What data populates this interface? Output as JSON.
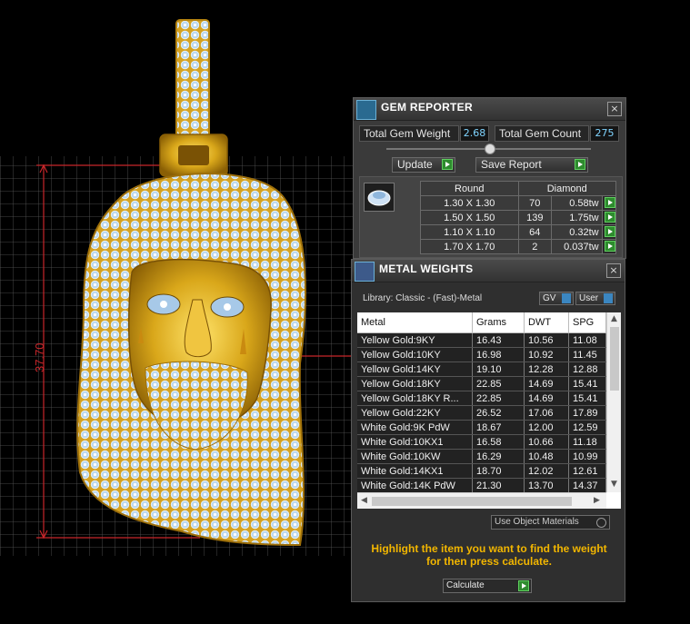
{
  "dimension_label": "37.70",
  "gem_reporter": {
    "title": "GEM REPORTER",
    "close": "×",
    "total_weight_label": "Total Gem Weight",
    "total_weight_value": "2.68",
    "total_count_label": "Total Gem Count",
    "total_count_value": "275",
    "update_label": "Update",
    "save_label": "Save Report",
    "header_shape": "Round",
    "header_material": "Diamond",
    "rows": [
      {
        "size": "1.30 X 1.30",
        "count": "70",
        "weight": "0.58tw"
      },
      {
        "size": "1.50 X 1.50",
        "count": "139",
        "weight": "1.75tw"
      },
      {
        "size": "1.10 X 1.10",
        "count": "64",
        "weight": "0.32tw"
      },
      {
        "size": "1.70 X 1.70",
        "count": "2",
        "weight": "0.037tw"
      }
    ]
  },
  "metal_weights": {
    "title": "METAL WEIGHTS",
    "close": "×",
    "library_label": "Library: Classic - (Fast)-Metal",
    "gv_label": "GV",
    "user_label": "User",
    "columns": [
      "Metal",
      "Grams",
      "DWT",
      "SPG"
    ],
    "rows": [
      [
        "Yellow Gold:9KY",
        "16.43",
        "10.56",
        "11.08"
      ],
      [
        "Yellow Gold:10KY",
        "16.98",
        "10.92",
        "11.45"
      ],
      [
        "Yellow Gold:14KY",
        "19.10",
        "12.28",
        "12.88"
      ],
      [
        "Yellow Gold:18KY",
        "22.85",
        "14.69",
        "15.41"
      ],
      [
        "Yellow Gold:18KY R...",
        "22.85",
        "14.69",
        "15.41"
      ],
      [
        "Yellow Gold:22KY",
        "26.52",
        "17.06",
        "17.89"
      ],
      [
        "White Gold:9K PdW",
        "18.67",
        "12.00",
        "12.59"
      ],
      [
        "White Gold:10KX1",
        "16.58",
        "10.66",
        "11.18"
      ],
      [
        "White Gold:10KW",
        "16.29",
        "10.48",
        "10.99"
      ],
      [
        "White Gold:14KX1",
        "18.70",
        "12.02",
        "12.61"
      ],
      [
        "White Gold:14K PdW",
        "21.30",
        "13.70",
        "14.37"
      ]
    ],
    "use_object_materials": "Use Object Materials",
    "message_line1": "Highlight the item you want to find the weight",
    "message_line2": "for then press calculate.",
    "calculate_label": "Calculate"
  }
}
